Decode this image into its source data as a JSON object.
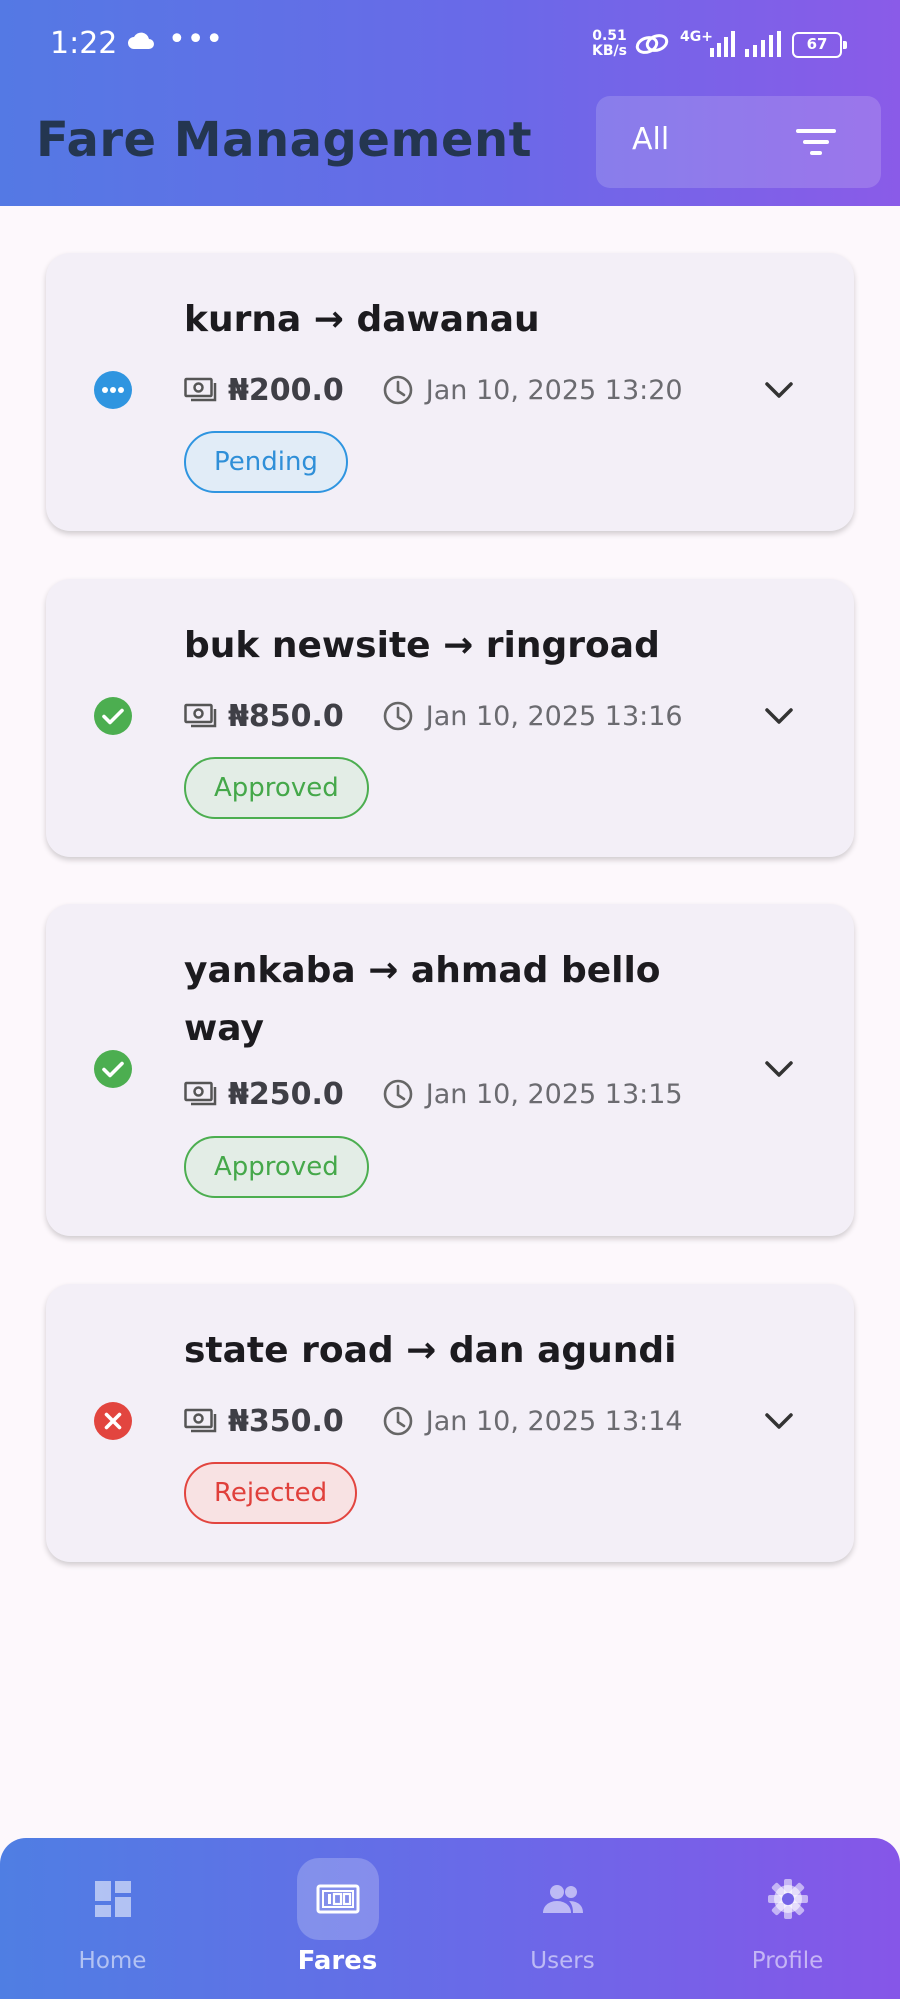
{
  "status_bar": {
    "time": "1:22",
    "dots": "•••",
    "speed_value": "0.51",
    "speed_unit": "KB/s",
    "network": "4G+",
    "battery": "67"
  },
  "header": {
    "title": "Fare Management",
    "filter_value": "All"
  },
  "fares": [
    {
      "route": "kurna → dawanau",
      "amount": "₦200.0",
      "datetime": "Jan 10, 2025 13:20",
      "status": "Pending"
    },
    {
      "route": "buk newsite → ringroad",
      "amount": "₦850.0",
      "datetime": "Jan 10, 2025 13:16",
      "status": "Approved"
    },
    {
      "route": "yankaba → ahmad bello way",
      "amount": "₦250.0",
      "datetime": "Jan 10, 2025 13:15",
      "status": "Approved"
    },
    {
      "route": "state road → dan agundi",
      "amount": "₦350.0",
      "datetime": "Jan 10, 2025 13:14",
      "status": "Rejected"
    }
  ],
  "nav": [
    {
      "label": "Home",
      "icon": "dashboard-icon",
      "active": false
    },
    {
      "label": "Fares",
      "icon": "money-icon",
      "active": true
    },
    {
      "label": "Users",
      "icon": "people-icon",
      "active": false
    },
    {
      "label": "Profile",
      "icon": "gear-icon",
      "active": false
    }
  ],
  "colors": {
    "pending": "#2f95e0",
    "approved": "#4cae50",
    "rejected": "#e2453f",
    "title": "#243650"
  }
}
